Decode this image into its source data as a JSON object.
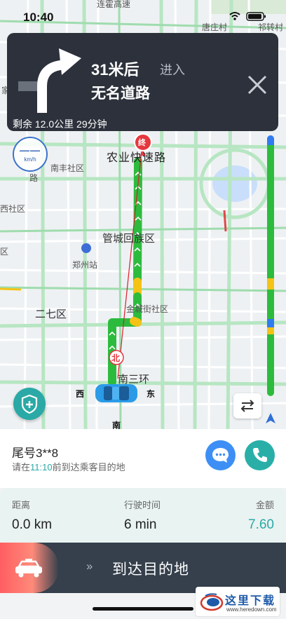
{
  "status_bar": {
    "time": "10:40"
  },
  "nav": {
    "distance": "31米后",
    "action": "进入",
    "road": "无名道路",
    "remaining": "剩余 12.0公里 29分钟",
    "speed_value": "——",
    "speed_unit": "km/h",
    "turn_icon": "turn-right-arrow-icon"
  },
  "map": {
    "labels": {
      "top_road": "连霍高速",
      "village_tang": "唐庄村",
      "village_qi": "祁转村",
      "nongye_road": "农业快速路",
      "nanfeng": "南丰社区",
      "xi_district": "西社区",
      "guancheng": "管城回族区",
      "zhengzhou_station": "郑州站",
      "erqi": "二七区",
      "jincheng": "金城街社区",
      "nansanhuan": "南三环",
      "jia": "家",
      "qu": "区",
      "lu": "路",
      "west": "西",
      "east": "东",
      "south": "南",
      "north": "北",
      "end": "终"
    },
    "traffic_colors": {
      "clear": "#2dbb3e",
      "slow": "#f4c316",
      "congested": "#e04848"
    }
  },
  "order": {
    "plate": "尾号3**8",
    "hint_pre": "请在",
    "hint_time": "11:10",
    "hint_post": "前到达乘客目的地"
  },
  "stats": {
    "distance_label": "距离",
    "distance_value": "0.0 km",
    "duration_label": "行驶时间",
    "duration_value": "6 min",
    "amount_label": "金额",
    "amount_value": "7.60"
  },
  "action": {
    "chevrons": "››",
    "label": "到达目的地"
  },
  "watermark": {
    "title": "这里下载",
    "url": "www.heredown.com"
  }
}
